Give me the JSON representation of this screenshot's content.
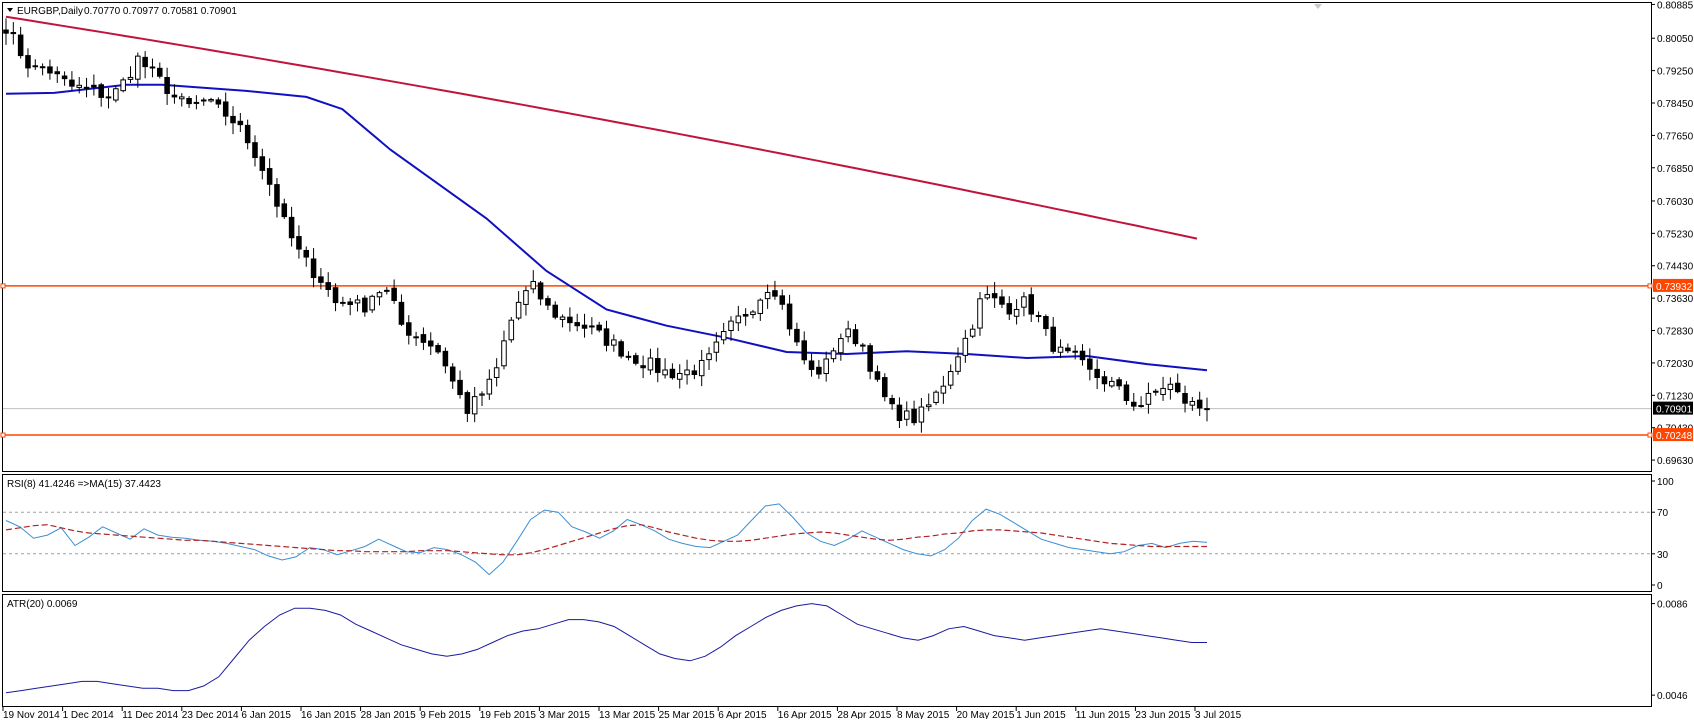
{
  "header": {
    "symbol": "EURGBP,Daily",
    "ohlc": "0.70770 0.70977 0.70581 0.70901"
  },
  "rsi": {
    "label": "RSI(8) 41.4246 =>MA(15) 37.4423",
    "levels": [
      30,
      70
    ]
  },
  "atr": {
    "label": "ATR(20) 0.0069"
  },
  "colors": {
    "ma_long": "#c0143c",
    "ma_mid": "#1010c0",
    "hline": "#ff4500",
    "rsi_line": "#3a8fd6",
    "rsi_ma": "#b22222",
    "atr_line": "#1a1aa0",
    "bull": "#ffffff",
    "bear": "#000000"
  },
  "chart_data": [
    {
      "type": "candlestick",
      "title": "EURGBP,Daily",
      "ylim": [
        0.6936,
        0.8092
      ],
      "price_ticks": [
        "0.80885",
        "0.80050",
        "0.79250",
        "0.78450",
        "0.77650",
        "0.76850",
        "0.76030",
        "0.75230",
        "0.74430",
        "0.73630",
        "0.72830",
        "0.72030",
        "0.71230",
        "0.70430",
        "0.69630"
      ],
      "x_labels": [
        "19 Nov 2014",
        "1 Dec 2014",
        "11 Dec 2014",
        "23 Dec 2014",
        "6 Jan 2015",
        "16 Jan 2015",
        "28 Jan 2015",
        "9 Feb 2015",
        "19 Feb 2015",
        "3 Mar 2015",
        "13 Mar 2015",
        "25 Mar 2015",
        "6 Apr 2015",
        "16 Apr 2015",
        "28 Apr 2015",
        "8 May 2015",
        "20 May 2015",
        "1 Jun 2015",
        "11 Jun 2015",
        "23 Jun 2015",
        "3 Jul 2015"
      ],
      "horizontal_lines": [
        {
          "value": 0.73932,
          "label": "0.73932"
        },
        {
          "value": 0.70248,
          "label": "0.70248"
        }
      ],
      "current_price": {
        "value": 0.70901,
        "label": "0.70901"
      },
      "close_anchors": [
        0.8035,
        0.7975,
        0.7925,
        0.7935,
        0.7905,
        0.7885,
        0.788,
        0.787,
        0.786,
        0.79,
        0.7955,
        0.792,
        0.789,
        0.785,
        0.7835,
        0.785,
        0.783,
        0.781,
        0.777,
        0.7715,
        0.7645,
        0.7555,
        0.7485,
        0.744,
        0.7405,
        0.735,
        0.736,
        0.7335,
        0.7385,
        0.7375,
        0.7295,
        0.7272,
        0.7255,
        0.7225,
        0.7145,
        0.7085,
        0.7125,
        0.7165,
        0.7285,
        0.7365,
        0.739,
        0.734,
        0.7315,
        0.7305,
        0.729,
        0.727,
        0.725,
        0.7225,
        0.721,
        0.7195,
        0.718,
        0.7178,
        0.7185,
        0.7198,
        0.725,
        0.7295,
        0.7325,
        0.736,
        0.7405,
        0.733,
        0.724,
        0.718,
        0.7188,
        0.7265,
        0.7275,
        0.7245,
        0.715,
        0.709,
        0.7072,
        0.7065,
        0.71,
        0.7152,
        0.722,
        0.728,
        0.737,
        0.7355,
        0.734,
        0.7355,
        0.7328,
        0.726,
        0.7225,
        0.7215,
        0.718,
        0.7165,
        0.7145,
        0.711,
        0.71,
        0.7125,
        0.7155,
        0.7115,
        0.7098,
        0.709
      ],
      "ma_long": {
        "start": 0.8058,
        "end": 0.751
      },
      "ma_mid": {
        "points": [
          [
            0,
            0.7868
          ],
          [
            0.04,
            0.787
          ],
          [
            0.1,
            0.789
          ],
          [
            0.13,
            0.789
          ],
          [
            0.2,
            0.7875
          ],
          [
            0.25,
            0.786
          ],
          [
            0.28,
            0.783
          ],
          [
            0.32,
            0.773
          ],
          [
            0.4,
            0.756
          ],
          [
            0.45,
            0.743
          ],
          [
            0.5,
            0.7335
          ],
          [
            0.55,
            0.7295
          ],
          [
            0.6,
            0.7265
          ],
          [
            0.65,
            0.723
          ],
          [
            0.7,
            0.7225
          ],
          [
            0.75,
            0.7232
          ],
          [
            0.8,
            0.7225
          ],
          [
            0.85,
            0.7215
          ],
          [
            0.9,
            0.722
          ],
          [
            0.95,
            0.72
          ],
          [
            1.0,
            0.7185
          ]
        ]
      }
    },
    {
      "type": "line",
      "title": "RSI(8) 41.4246 =>MA(15) 37.4423",
      "ylim": [
        0,
        100
      ],
      "y_ticks": [
        "100",
        "70",
        "30",
        "0"
      ],
      "series": [
        {
          "name": "RSI(8)",
          "values": [
            62,
            56,
            45,
            48,
            55,
            38,
            46,
            56,
            50,
            44,
            54,
            48,
            46,
            45,
            43,
            42,
            40,
            37,
            34,
            28,
            24,
            27,
            36,
            34,
            29,
            33,
            37,
            44,
            38,
            32,
            31,
            36,
            34,
            29,
            22,
            10,
            22,
            42,
            63,
            72,
            70,
            56,
            51,
            45,
            52,
            63,
            58,
            52,
            44,
            40,
            37,
            36,
            42,
            48,
            62,
            76,
            78,
            65,
            50,
            42,
            38,
            44,
            52,
            46,
            40,
            34,
            30,
            28,
            34,
            45,
            62,
            73,
            68,
            60,
            52,
            44,
            40,
            36,
            34,
            32,
            30,
            32,
            38,
            40,
            36,
            40,
            42,
            41
          ]
        },
        {
          "name": "MA(15)",
          "values": [
            53,
            55,
            57,
            58,
            55,
            52,
            50,
            49,
            48,
            47,
            46,
            45,
            44,
            43,
            43,
            42,
            41,
            40,
            39,
            38,
            37,
            36,
            35,
            34,
            33,
            33,
            32,
            32,
            32,
            32,
            33,
            33,
            33,
            32,
            31,
            30,
            29,
            29,
            31,
            34,
            38,
            42,
            46,
            50,
            54,
            57,
            58,
            55,
            51,
            48,
            45,
            43,
            42,
            42,
            43,
            45,
            47,
            49,
            50,
            51,
            50,
            48,
            46,
            44,
            43,
            44,
            46,
            47,
            49,
            50,
            52,
            53,
            53,
            52,
            51,
            50,
            48,
            46,
            44,
            42,
            40,
            39,
            38,
            37,
            37,
            37,
            37,
            37
          ]
        }
      ]
    },
    {
      "type": "line",
      "title": "ATR(20) 0.0069",
      "ylim": [
        0.0043,
        0.0088
      ],
      "y_ticks": [
        "0.0086",
        "0.0046"
      ],
      "series": [
        {
          "name": "ATR(20)",
          "values": [
            0.0047,
            0.0048,
            0.0049,
            0.005,
            0.0051,
            0.0052,
            0.0052,
            0.0051,
            0.005,
            0.0049,
            0.0049,
            0.0048,
            0.0048,
            0.005,
            0.0054,
            0.0062,
            0.007,
            0.0076,
            0.0081,
            0.0084,
            0.0084,
            0.0083,
            0.0081,
            0.0077,
            0.0074,
            0.0071,
            0.0068,
            0.0066,
            0.0064,
            0.0063,
            0.0064,
            0.0066,
            0.0069,
            0.0072,
            0.0074,
            0.0075,
            0.0077,
            0.0079,
            0.0079,
            0.0078,
            0.0076,
            0.0072,
            0.0068,
            0.0064,
            0.0062,
            0.0061,
            0.0063,
            0.0067,
            0.0072,
            0.0076,
            0.008,
            0.0083,
            0.0085,
            0.0086,
            0.0085,
            0.0081,
            0.0077,
            0.0075,
            0.0073,
            0.0071,
            0.007,
            0.0072,
            0.0075,
            0.0076,
            0.0074,
            0.0072,
            0.0071,
            0.007,
            0.0071,
            0.0072,
            0.0073,
            0.0074,
            0.0075,
            0.0074,
            0.0073,
            0.0072,
            0.0071,
            0.007,
            0.0069,
            0.0069
          ]
        }
      ]
    }
  ]
}
